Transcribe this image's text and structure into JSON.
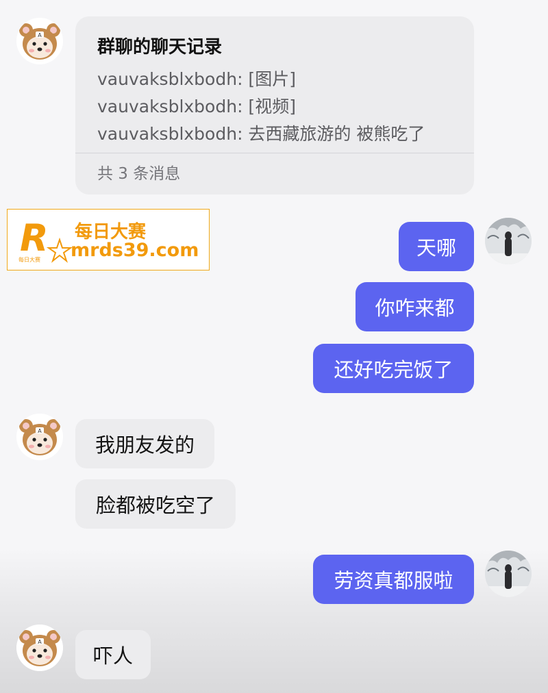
{
  "forwarded_card": {
    "title": "群聊的聊天记录",
    "lines": [
      "vauvaksblxbodh: [图片]",
      "vauvaksblxbodh: [视频]",
      "vauvaksblxbodh: 去西藏旅游的 被熊吃了"
    ],
    "footer": "共 3 条消息"
  },
  "watermark": {
    "logo_letter": "R",
    "logo_caption": "每日大赛",
    "name": "每日大赛",
    "url": "mrds39.com"
  },
  "messages": [
    {
      "sender": "self",
      "text": "天哪"
    },
    {
      "sender": "self",
      "text": "你咋来都"
    },
    {
      "sender": "self",
      "text": "还好吃完饭了"
    },
    {
      "sender": "other",
      "text": "我朋友发的"
    },
    {
      "sender": "other",
      "text": "脸都被吃空了"
    },
    {
      "sender": "self",
      "text": "劳资真都服啦"
    },
    {
      "sender": "other",
      "text": "吓人"
    }
  ],
  "colors": {
    "outgoing_bubble": "#5c64f0",
    "incoming_bubble": "#ececee",
    "watermark": "#f29a0c"
  }
}
